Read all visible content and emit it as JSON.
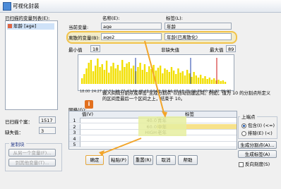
{
  "window": {
    "title": "可视化封装"
  },
  "scanned_list": {
    "label": "已扫描的变量列表(E):",
    "items": [
      {
        "label": "年龄 [age]"
      }
    ]
  },
  "current_var": {
    "label": "当前变量:",
    "name_header": "名称(E):",
    "label_header": "标签(L):",
    "name": "age",
    "tag": "年龄"
  },
  "binned_var": {
    "label": "离散的变量(B):",
    "name": "age2",
    "tag": "年龄(已离散化)"
  },
  "stats": {
    "min_label": "最小值",
    "min": "18",
    "nonmissing_label": "非缺失值",
    "max_label": "最大值",
    "max": "89"
  },
  "histogram": {
    "ticks": [
      "18.00",
      "24.27",
      "30.52",
      "36.77",
      "42.46",
      "48.43",
      "54.00",
      "59.64",
      "65.18",
      "71.03",
      "76.60",
      "82.31",
      "89.00"
    ]
  },
  "instructions": "输入间隔分割点或单击\"生成分割点\"以自动创建区间。例如，值为 10 的分割点所定义的区间是最后一个区间之上，结束于 10。",
  "cases": {
    "scanned_label": "已扫描个案：",
    "scanned": "1517",
    "missing_label": "缺失值：",
    "missing": "3"
  },
  "copy_group": {
    "label": "复制块",
    "from_btn": "从另一个变量(F)...",
    "to_btn": "到其他变量(T)..."
  },
  "grid": {
    "label": "网格(G):",
    "col_value": "值(V)",
    "col_tag": "标签",
    "rows": [
      {
        "num": "1",
        "value": "40.0",
        "tag": "青年"
      },
      {
        "num": "2",
        "value": "60.0",
        "tag": "中年"
      },
      {
        "num": "3",
        "value": "HIGH",
        "tag": "老年"
      },
      {
        "num": "4",
        "value": "",
        "tag": ""
      },
      {
        "num": "5",
        "value": "",
        "tag": ""
      }
    ]
  },
  "endpoints": {
    "label": "上端点",
    "opt_include": "包含(I) (<=)",
    "opt_exclude": "排除(E) (<)"
  },
  "right_buttons": {
    "gen_cut": "生成分割点(A)...",
    "gen_tag": "生成标签(A)",
    "reverse": "反向刻度(S)"
  },
  "footer": {
    "ok": "确定",
    "paste": "粘贴(P)",
    "reset": "重置(R)",
    "cancel": "取消",
    "help": "帮助"
  }
}
